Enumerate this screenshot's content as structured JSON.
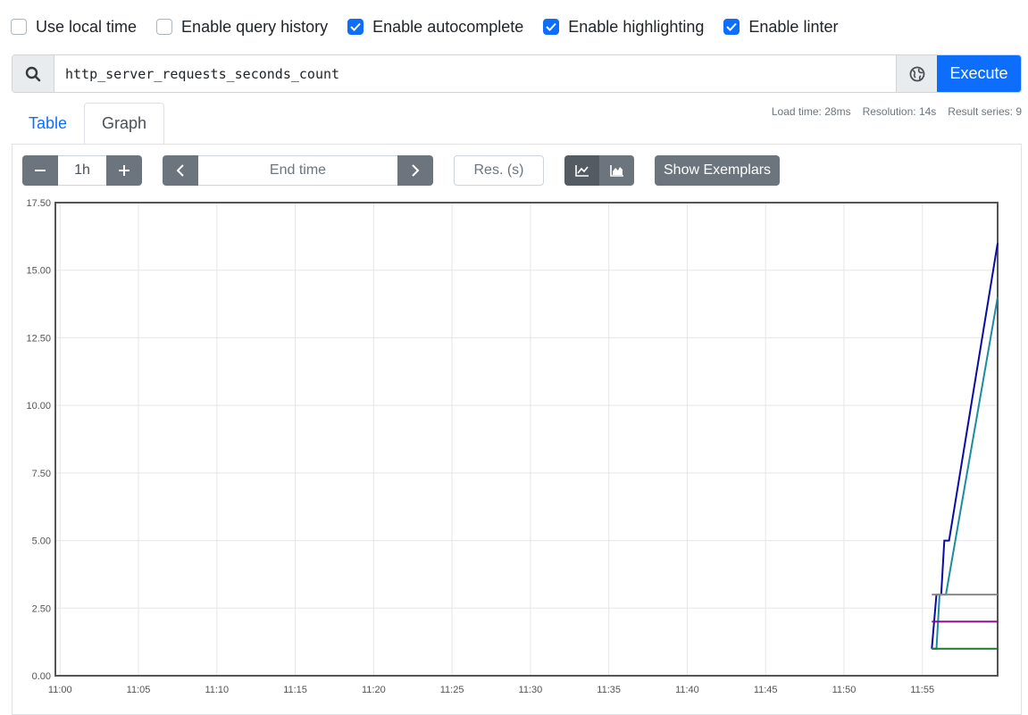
{
  "options": [
    {
      "label": "Use local time",
      "checked": false
    },
    {
      "label": "Enable query history",
      "checked": false
    },
    {
      "label": "Enable autocomplete",
      "checked": true
    },
    {
      "label": "Enable highlighting",
      "checked": true
    },
    {
      "label": "Enable linter",
      "checked": true
    }
  ],
  "query": {
    "value": "http_server_requests_seconds_count",
    "execute_label": "Execute",
    "search_icon": "search-icon",
    "globe_icon": "globe-icon"
  },
  "tabs": [
    {
      "label": "Table",
      "active": false
    },
    {
      "label": "Graph",
      "active": true
    }
  ],
  "stats": {
    "load_time": "Load time: 28ms",
    "resolution": "Resolution: 14s",
    "result_series": "Result series: 9"
  },
  "controls": {
    "range_value": "1h",
    "end_time_placeholder": "End time",
    "resolution_placeholder": "Res. (s)",
    "show_exemplars_label": "Show Exemplars",
    "stacked_mode": "lines"
  },
  "colors": {
    "primary": "#0d6efd",
    "grey_button": "#6c757d"
  },
  "chart_data": {
    "type": "line",
    "x_ticks": [
      "11:00",
      "11:05",
      "11:10",
      "11:15",
      "11:20",
      "11:25",
      "11:30",
      "11:35",
      "11:40",
      "11:45",
      "11:50",
      "11:55"
    ],
    "y_ticks": [
      "0.00",
      "2.50",
      "5.00",
      "7.50",
      "10.00",
      "12.50",
      "15.00",
      "17.50"
    ],
    "ylim": [
      0,
      17.5
    ],
    "xlim_minutes": [
      -0.3,
      59.8
    ],
    "grid": true,
    "series": [
      {
        "color": "#0a0aa4",
        "points": [
          [
            55.6,
            1
          ],
          [
            55.9,
            3
          ],
          [
            56.2,
            3
          ],
          [
            56.4,
            5
          ],
          [
            56.7,
            5
          ],
          [
            59.8,
            16
          ]
        ]
      },
      {
        "color": "#1a8ca0",
        "points": [
          [
            55.6,
            1
          ],
          [
            55.9,
            1
          ],
          [
            56.1,
            3
          ],
          [
            56.5,
            3
          ],
          [
            59.8,
            14
          ]
        ]
      },
      {
        "color": "#888888",
        "points": [
          [
            55.6,
            3
          ],
          [
            59.8,
            3
          ]
        ]
      },
      {
        "color": "#8c0a8c",
        "points": [
          [
            55.6,
            2
          ],
          [
            59.8,
            2
          ]
        ]
      },
      {
        "color": "#1a7a2a",
        "points": [
          [
            55.6,
            1
          ],
          [
            59.8,
            1
          ]
        ]
      }
    ]
  }
}
